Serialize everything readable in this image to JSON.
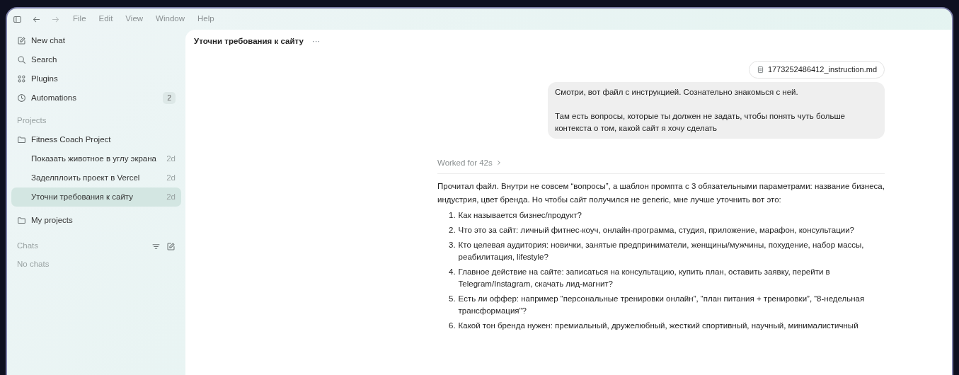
{
  "menu_bar": {
    "items": [
      "File",
      "Edit",
      "View",
      "Window",
      "Help"
    ]
  },
  "sidebar": {
    "nav": [
      {
        "label": "New chat"
      },
      {
        "label": "Search"
      },
      {
        "label": "Plugins"
      },
      {
        "label": "Automations",
        "count": "2"
      }
    ],
    "projects_heading": "Projects",
    "projects": [
      {
        "label": "Fitness Coach Project",
        "threads": [
          {
            "title": "Показать животное в углу экрана",
            "age": "2d",
            "selected": false
          },
          {
            "title": "Заделплоить проект в Vercel",
            "age": "2d",
            "selected": false
          },
          {
            "title": "Уточни требования к сайту",
            "age": "2d",
            "selected": true
          }
        ]
      },
      {
        "label": "My projects"
      }
    ],
    "chats_heading": "Chats",
    "chats_empty": "No chats"
  },
  "chat": {
    "title": "Уточни требования к сайту",
    "more": "···",
    "attachment": "1773252486412_instruction.md",
    "user_message": [
      "Смотри, вот файл с инструкцией. Сознательно знакомься с ней.",
      "Там есть вопросы, которые ты должен не задать, чтобы понять чуть больше контекста о том, какой сайт я хочу сделать"
    ],
    "worked": "Worked for 42s",
    "reply_intro": "Прочитал файл. Внутри не совсем “вопросы”, а шаблон промпта с 3 обязательными параметрами: название бизнеса, индустрия, цвет бренда. Но чтобы сайт получился не generic, мне лучше уточнить вот это:",
    "questions": [
      {
        "number": "1.",
        "text": "Как называется бизнес/продукт?"
      },
      {
        "number": "2.",
        "text": "Что это за сайт: личный фитнес-коуч, онлайн-программа, студия, приложение, марафон, консультации?"
      },
      {
        "number": "3.",
        "text": "Кто целевая аудитория: новички, занятые предприниматели, женщины/мужчины, похудение, набор массы, реабилитация, lifestyle?"
      },
      {
        "number": "4.",
        "text": "Главное действие на сайте: записаться на консультацию, купить план, оставить заявку, перейти в Telegram/Instagram, скачать лид-магнит?"
      },
      {
        "number": "5.",
        "text": "Есть ли оффер: например “персональные тренировки онлайн”, “план питания + тренировки”, “8-недельная трансформация”?"
      },
      {
        "number": "6.",
        "text": "Какой тон бренда нужен: премиальный, дружелюбный, жесткий спортивный, научный, минималистичный"
      }
    ]
  }
}
